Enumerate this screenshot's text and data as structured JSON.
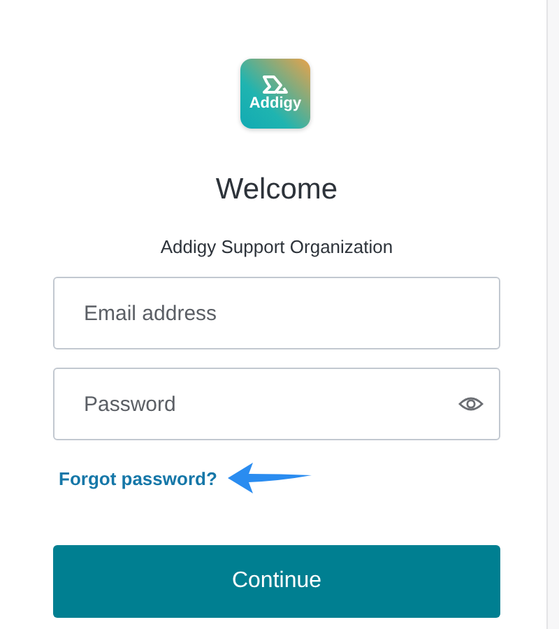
{
  "logo": {
    "text": "Addigy"
  },
  "title": "Welcome",
  "subtitle": "Addigy Support Organization",
  "fields": [
    {
      "kind": "text",
      "placeholder": "Email address"
    },
    {
      "kind": "password",
      "placeholder": "Password"
    }
  ],
  "forgot_link": "Forgot password?",
  "button": "Continue"
}
